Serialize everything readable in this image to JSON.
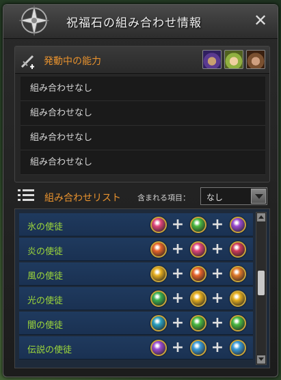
{
  "window": {
    "title": "祝福石の組み合わせ情報",
    "close_label": "✕"
  },
  "active_section": {
    "title": "発動中の能力",
    "rows": [
      "組み合わせなし",
      "組み合わせなし",
      "組み合わせなし",
      "組み合わせなし"
    ]
  },
  "list_section": {
    "title": "組み合わせリスト",
    "filter_label": "含まれる項目：",
    "filter_value": "なし"
  },
  "combos": [
    {
      "name": "氷の使徒",
      "gems": [
        "#e0457a",
        "#4ab840",
        "#9a4ad0"
      ]
    },
    {
      "name": "炎の使徒",
      "gems": [
        "#e8642a",
        "#e0457a",
        "#d03a5a"
      ]
    },
    {
      "name": "風の使徒",
      "gems": [
        "#e8b020",
        "#e8642a",
        "#e07a2a"
      ]
    },
    {
      "name": "光の使徒",
      "gems": [
        "#3ab050",
        "#e8b020",
        "#e8b020"
      ]
    },
    {
      "name": "闇の使徒",
      "gems": [
        "#2aa0c0",
        "#4ab840",
        "#4ab840"
      ]
    },
    {
      "name": "伝説の使徒",
      "gems": [
        "#9a4ad0",
        "#3a9ad8",
        "#3a9ad8"
      ]
    }
  ],
  "icons": {
    "compass": "compass-icon",
    "sword": "sword-icon",
    "list": "list-icon",
    "close": "close-icon"
  },
  "colors": {
    "accent": "#e8922e",
    "combo_name": "#9ed83a",
    "row_blue": "#1f3a5e"
  }
}
